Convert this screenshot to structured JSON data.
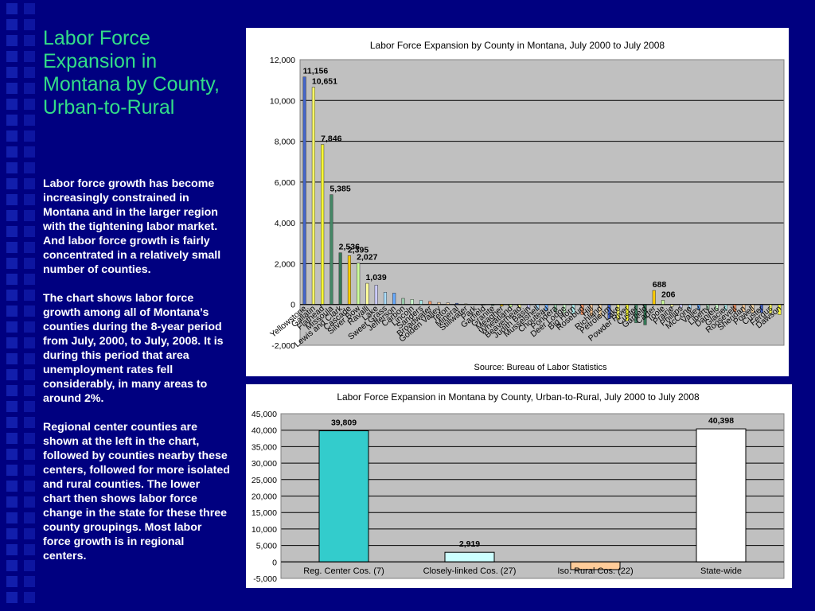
{
  "slide": {
    "title": "Labor Force Expansion in Montana by County, Urban-to-Rural",
    "paragraphs": [
      "Labor force growth has become increasingly constrained in Montana and in the larger region with the tightening labor market.  And labor force growth is fairly concentrated in a relatively small number of counties.",
      "The chart shows labor force growth among all of Montana’s counties during the 8-year period from July, 2000, to July, 2008.  It is during this period that area unemployment rates fell considerably, in many areas to around 2%.",
      "Regional center counties are shown at the left in the chart, followed by counties nearby these centers, followed for more isolated and rural counties.  The lower chart then shows labor force change in the state for these three county groupings.  Most labor force growth is in regional centers."
    ]
  },
  "chart_data": [
    {
      "type": "bar",
      "title": "Labor Force Expansion by County in Montana, July 2000 to July 2008",
      "footer": "Source: Bureau of Labor Statistics",
      "xlabel": "",
      "ylabel": "",
      "ylim": [
        -2000,
        12000
      ],
      "yticks": [
        -2000,
        0,
        2000,
        4000,
        6000,
        8000,
        10000,
        12000
      ],
      "ytick_labels": [
        "-2,000",
        "0",
        "2,000",
        "4,000",
        "6,000",
        "8,000",
        "10,000",
        "12,000"
      ],
      "grid": true,
      "categories": [
        "Yellowstone",
        "Gallatin",
        "Flathead",
        "Missoula",
        "Lewis and Clark",
        "Cascade",
        "Silver Bow",
        "Ravalli",
        "Lake",
        "Sweet Grass",
        "Jefferson",
        "Carbon",
        "Lincoln",
        "Sanders",
        "Broadwater",
        "Golden Valley",
        "Teton",
        "Mineral",
        "Stillwater",
        "Park",
        "Garfield",
        "Granite",
        "Meagher",
        "Wheatland",
        "Beaverhead",
        "Judith Basin",
        "Musselshell",
        "Chouteau",
        "Pondera",
        "Deer Lodge",
        "Big Horn",
        "Rosebud",
        "Hill",
        "Richland",
        "Petroleum",
        "Lake",
        "Powder River",
        "Custer",
        "Garfield",
        "Carter",
        "Toole",
        "Prairie",
        "Phillips",
        "McCone",
        "Valley",
        "Liberty",
        "Daniels",
        "Glacier",
        "Roosevelt",
        "Sheridan",
        "Powell",
        "Custer",
        "Fergus",
        "Dawson"
      ],
      "values": [
        11156,
        10651,
        7846,
        5385,
        2536,
        2395,
        2027,
        1039,
        950,
        600,
        560,
        300,
        250,
        200,
        150,
        100,
        80,
        60,
        30,
        10,
        -30,
        -50,
        -80,
        -120,
        -160,
        -200,
        -250,
        -300,
        -350,
        -400,
        -450,
        -500,
        -550,
        -600,
        -700,
        -750,
        -800,
        -900,
        -1000,
        688,
        206,
        -100,
        -150,
        -200,
        -250,
        -250,
        -300,
        -300,
        -350,
        -350,
        -400,
        -400,
        -450,
        -500
      ],
      "value_labels": {
        "0": "11,156",
        "1": "10,651",
        "2": "7,846",
        "3": "5,385",
        "4": "2,536",
        "5": "2,395",
        "6": "2,027",
        "7": "1,039",
        "39": "688",
        "40": "206"
      },
      "group_colors": [
        "#4466cc",
        "#ffff66",
        "#ffff33",
        "#448866",
        "#337755",
        "#ffcc00",
        "#ccff99",
        "#ffff99",
        "#ccccff",
        "#aaddff",
        "#66aaff",
        "#99ccaa",
        "#ccffcc",
        "#aaeeee",
        "#ff9966",
        "#ffcc99",
        "#ffddaa"
      ]
    },
    {
      "type": "bar",
      "title": "Labor Force Expansion in Montana by County, Urban-to-Rural, July 2000 to July 2008",
      "xlabel": "",
      "ylabel": "",
      "ylim": [
        -5000,
        45000
      ],
      "yticks": [
        -5000,
        0,
        5000,
        10000,
        15000,
        20000,
        25000,
        30000,
        35000,
        40000,
        45000
      ],
      "ytick_labels": [
        "-5,000",
        "0",
        "5,000",
        "10,000",
        "15,000",
        "20,000",
        "25,000",
        "30,000",
        "35,000",
        "40,000",
        "45,000"
      ],
      "grid": true,
      "categories": [
        "Reg. Center Cos. (7)",
        "Closely-linked Cos. (27)",
        "Iso. Rural Cos. (22)",
        "State-wide"
      ],
      "values": [
        39809,
        2919,
        -2330,
        40398
      ],
      "value_labels": [
        "39,809",
        "2,919",
        "",
        "40,398"
      ],
      "colors": [
        "#33cccc",
        "#ccffff",
        "#ffcc99",
        "#ffffff"
      ]
    }
  ],
  "colors": {
    "background": "#000080",
    "title": "#33dd88",
    "body_text": "#ffffff",
    "panel": "#ffffff"
  }
}
